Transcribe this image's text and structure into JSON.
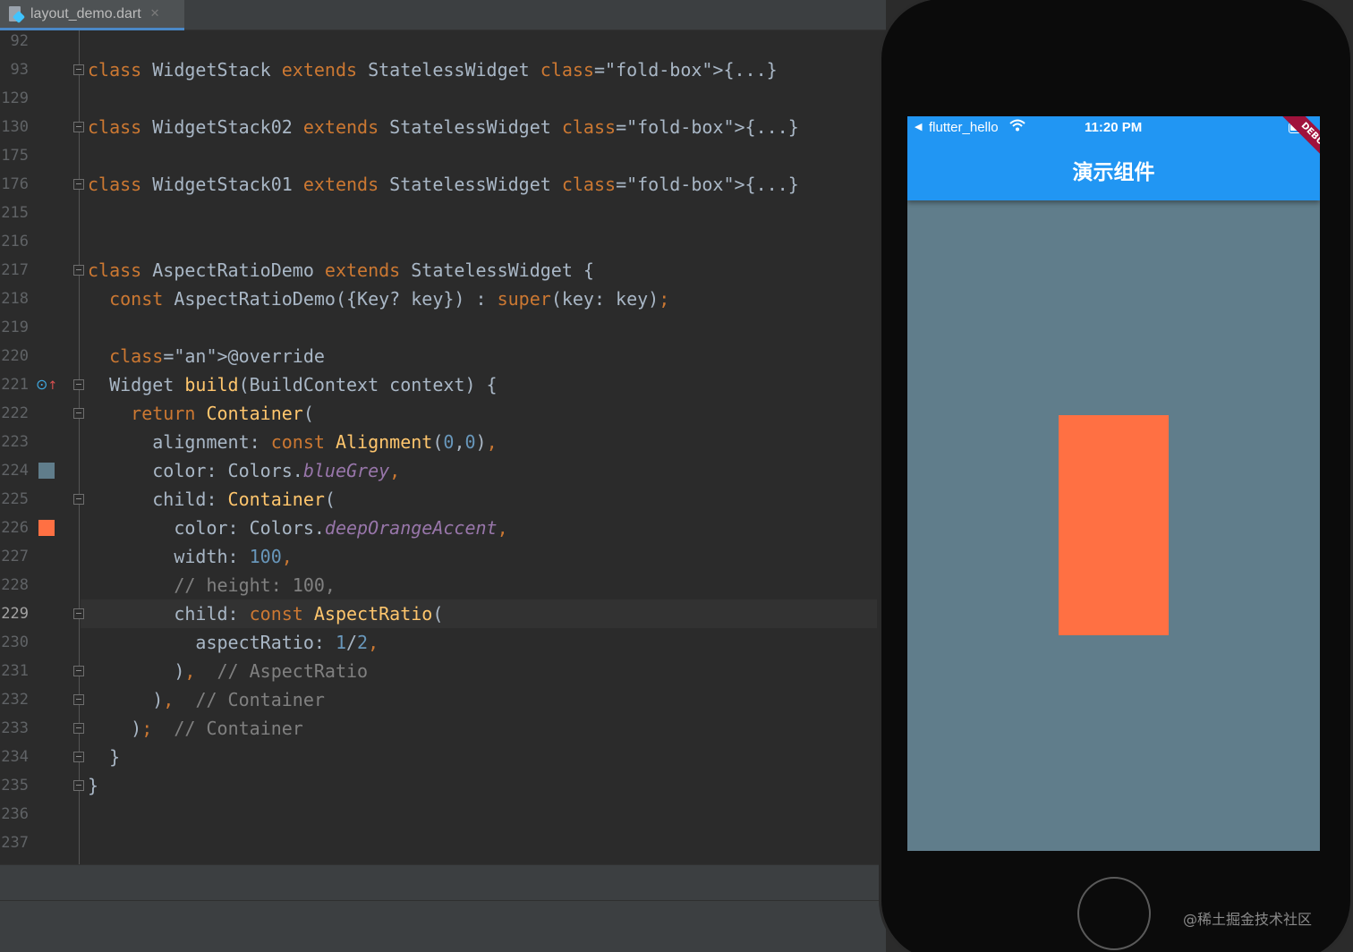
{
  "tab": {
    "filename": "layout_demo.dart",
    "close": "✕"
  },
  "colors": {
    "keyword": "#cc7832",
    "function": "#ffc66d",
    "number": "#6897bb",
    "comment": "#808080",
    "annotation": "#bbb529",
    "field": "#9876aa",
    "blueGrey": "#607d8b",
    "deepOrangeAccent": "#ff7043",
    "appbar": "#2196f3"
  },
  "editor": {
    "lines": [
      {
        "n": "92",
        "text": ""
      },
      {
        "n": "93",
        "text": "class WidgetStack extends StatelessWidget {...}"
      },
      {
        "n": "129",
        "text": ""
      },
      {
        "n": "130",
        "text": "class WidgetStack02 extends StatelessWidget {...}"
      },
      {
        "n": "175",
        "text": ""
      },
      {
        "n": "176",
        "text": "class WidgetStack01 extends StatelessWidget {...}"
      },
      {
        "n": "215",
        "text": ""
      },
      {
        "n": "216",
        "text": ""
      },
      {
        "n": "217",
        "text": "class AspectRatioDemo extends StatelessWidget {"
      },
      {
        "n": "218",
        "text": "  const AspectRatioDemo({Key? key}) : super(key: key);"
      },
      {
        "n": "219",
        "text": ""
      },
      {
        "n": "220",
        "text": "  @override"
      },
      {
        "n": "221",
        "text": "  Widget build(BuildContext context) {"
      },
      {
        "n": "222",
        "text": "    return Container("
      },
      {
        "n": "223",
        "text": "      alignment: const Alignment(0,0),"
      },
      {
        "n": "224",
        "text": "      color: Colors.blueGrey,"
      },
      {
        "n": "225",
        "text": "      child: Container("
      },
      {
        "n": "226",
        "text": "        color: Colors.deepOrangeAccent,"
      },
      {
        "n": "227",
        "text": "        width: 100,"
      },
      {
        "n": "228",
        "text": "        // height: 100,"
      },
      {
        "n": "229",
        "text": "        child: const AspectRatio("
      },
      {
        "n": "230",
        "text": "          aspectRatio: 1/2,"
      },
      {
        "n": "231",
        "text": "        ),  // AspectRatio"
      },
      {
        "n": "232",
        "text": "      ),  // Container"
      },
      {
        "n": "233",
        "text": "    );  // Container"
      },
      {
        "n": "234",
        "text": "  }"
      },
      {
        "n": "235",
        "text": "}"
      },
      {
        "n": "236",
        "text": ""
      },
      {
        "n": "237",
        "text": ""
      }
    ],
    "active_line": "229"
  },
  "phone": {
    "back": "◀",
    "carrier": "flutter_hello",
    "wifi": "wifi-icon",
    "time": "11:20 PM",
    "battery": "battery-icon",
    "title": "演示组件",
    "debug": "DEBUG"
  },
  "watermark": "@稀土掘金技术社区"
}
